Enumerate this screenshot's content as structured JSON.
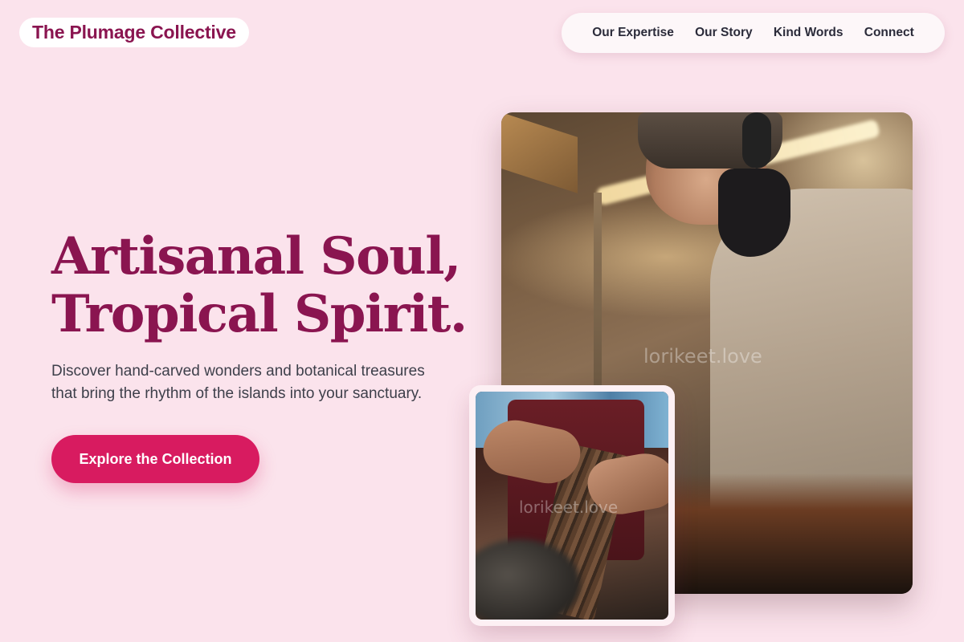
{
  "brand": {
    "name": "The Plumage Collective"
  },
  "nav": {
    "items": [
      {
        "label": "Our Expertise"
      },
      {
        "label": "Our Story"
      },
      {
        "label": "Kind Words"
      },
      {
        "label": "Connect"
      }
    ]
  },
  "hero": {
    "headline_line1": "Artisanal Soul,",
    "headline_line2": "Tropical Spirit.",
    "subtitle": "Discover hand-carved wonders and botanical treasures that bring the rhythm of the islands into your sanctuary.",
    "cta_label": "Explore the Collection"
  },
  "images": {
    "main_watermark": "lorikeet.love",
    "small_watermark": "lorikeet.love"
  },
  "colors": {
    "background": "#fbe3ec",
    "brand": "#8a1550",
    "accent": "#d81b60"
  }
}
